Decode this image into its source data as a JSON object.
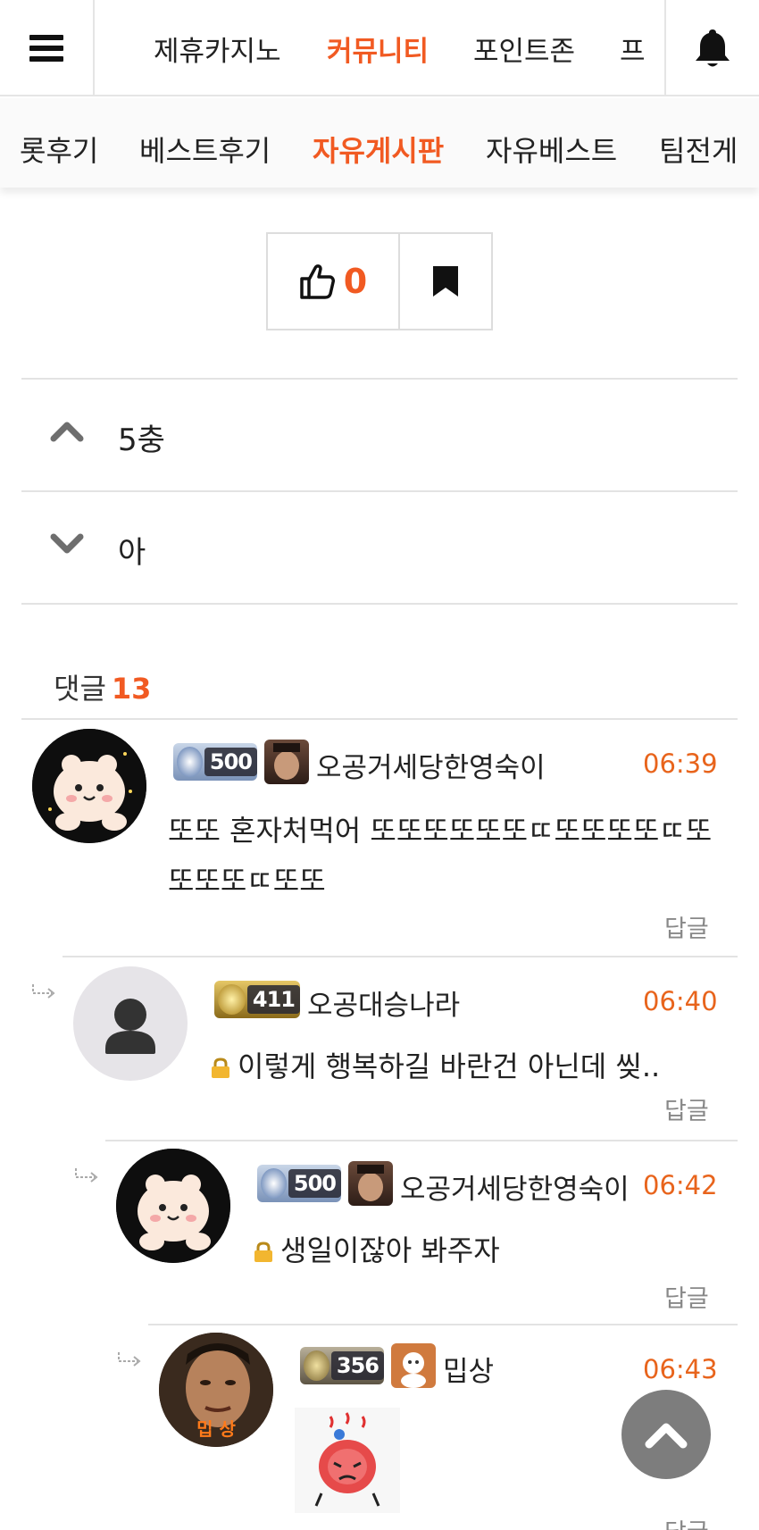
{
  "top_nav": {
    "items": [
      "제휴카지노",
      "커뮤니티",
      "포인트존",
      "프"
    ],
    "active_index": 1
  },
  "sub_nav": {
    "items": [
      "롯후기",
      "베스트후기",
      "자유게시판",
      "자유베스트",
      "팀전게"
    ],
    "active_index": 2
  },
  "actions": {
    "like_count": "0"
  },
  "post_nav": {
    "prev_title": "5충",
    "next_title": "아"
  },
  "comments_header": {
    "label": "댓글",
    "count": "13"
  },
  "comments": [
    {
      "level": "500",
      "nickname": "오공거세당한영숙이",
      "time": "06:39",
      "text": "또또 혼자처먹어 또또또또또또ㄸ또또또또ㄸ또 또또또ㄸ또또",
      "reply_label": "답글"
    },
    {
      "level": "411",
      "nickname": "오공대승나라",
      "time": "06:40",
      "text": "이렇게 행복하길 바란건 아닌데 씾..",
      "reply_label": "답글"
    },
    {
      "level": "500",
      "nickname": "오공거세당한영숙이",
      "time": "06:42",
      "text": "생일이잖아 봐주자",
      "reply_label": "답글"
    },
    {
      "level": "356",
      "nickname": "밉상",
      "time": "06:43",
      "reply_label": "답글"
    }
  ],
  "avatar_labels": {
    "mipsang": "밉 상"
  },
  "colors": {
    "accent": "#f15a22",
    "time": "#e8641c",
    "divider": "#e3e3e3"
  }
}
